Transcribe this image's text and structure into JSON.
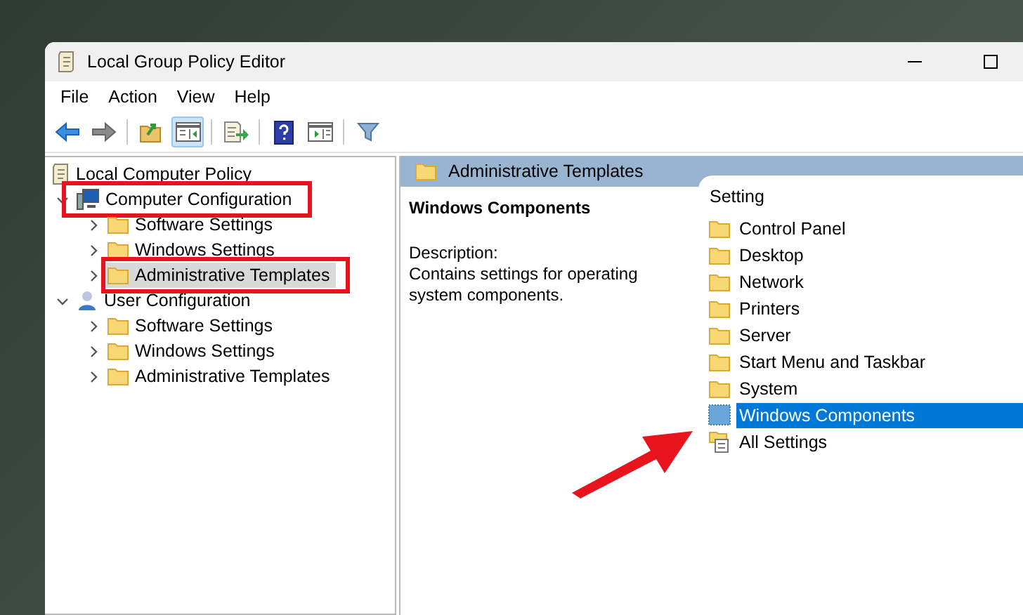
{
  "window": {
    "title": "Local Group Policy Editor"
  },
  "menu": [
    "File",
    "Action",
    "View",
    "Help"
  ],
  "toolbar": [
    {
      "kind": "back",
      "selected": false
    },
    {
      "kind": "forward",
      "selected": false
    },
    {
      "kind": "up",
      "selected": false
    },
    {
      "kind": "tree",
      "selected": true
    },
    {
      "kind": "export",
      "selected": false
    },
    {
      "kind": "help",
      "selected": false
    },
    {
      "kind": "pane",
      "selected": false
    },
    {
      "kind": "filter",
      "selected": false
    }
  ],
  "tree": [
    {
      "label": "Local Computer Policy",
      "kind": "policy",
      "selected": false,
      "children": [
        {
          "label": "Computer Configuration",
          "kind": "computer",
          "expanded": true,
          "selected": false,
          "highlighted": true,
          "children": [
            {
              "label": "Software Settings",
              "kind": "folder",
              "expanded": false,
              "selected": false,
              "highlighted": false
            },
            {
              "label": "Windows Settings",
              "kind": "folder",
              "expanded": false,
              "selected": false,
              "highlighted": false
            },
            {
              "label": "Administrative Templates",
              "kind": "folder",
              "expanded": false,
              "selected": true,
              "highlighted": true
            }
          ]
        },
        {
          "label": "User Configuration",
          "kind": "user",
          "expanded": true,
          "selected": false,
          "highlighted": false,
          "children": [
            {
              "label": "Software Settings",
              "kind": "folder",
              "expanded": false,
              "selected": false,
              "highlighted": false
            },
            {
              "label": "Windows Settings",
              "kind": "folder",
              "expanded": false,
              "selected": false,
              "highlighted": false
            },
            {
              "label": "Administrative Templates",
              "kind": "folder",
              "expanded": false,
              "selected": false,
              "highlighted": false
            }
          ]
        }
      ]
    }
  ],
  "details": {
    "header": "Administrative Templates",
    "title": "Windows Components",
    "description_label": "Description:",
    "description": "Contains settings for operating system components.",
    "column": "Setting",
    "items": [
      {
        "label": "Control Panel",
        "kind": "folder",
        "selected": false
      },
      {
        "label": "Desktop",
        "kind": "folder",
        "selected": false
      },
      {
        "label": "Network",
        "kind": "folder",
        "selected": false
      },
      {
        "label": "Printers",
        "kind": "folder",
        "selected": false
      },
      {
        "label": "Server",
        "kind": "folder",
        "selected": false
      },
      {
        "label": "Start Menu and Taskbar",
        "kind": "folder",
        "selected": false
      },
      {
        "label": "System",
        "kind": "folder",
        "selected": false
      },
      {
        "label": "Windows Components",
        "kind": "components",
        "selected": true
      },
      {
        "label": "All Settings",
        "kind": "all",
        "selected": false
      }
    ]
  }
}
